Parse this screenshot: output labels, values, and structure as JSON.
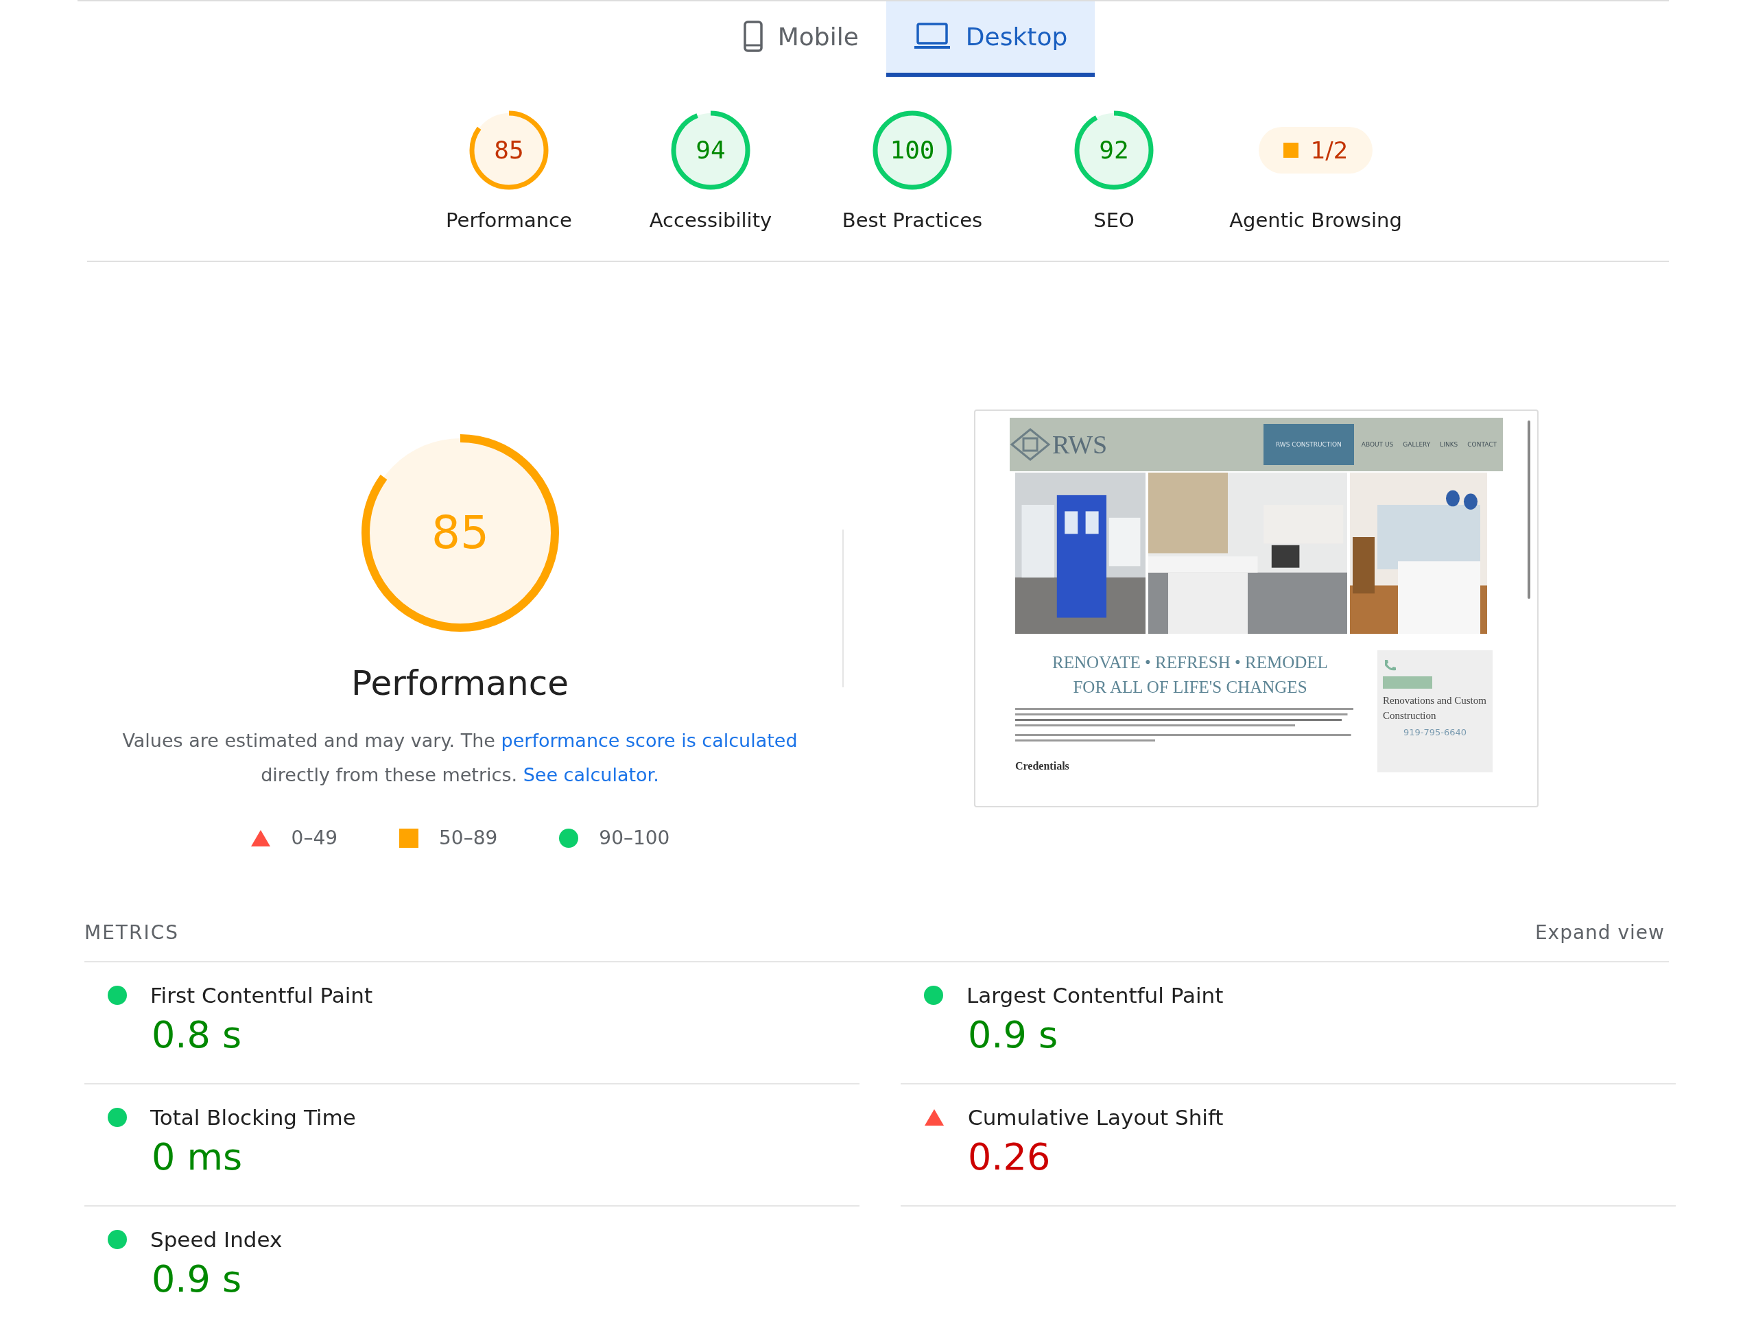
{
  "tabs": [
    {
      "label": "Mobile",
      "kind": "mobile",
      "selected": false
    },
    {
      "label": "Desktop",
      "kind": "desktop",
      "selected": true
    }
  ],
  "categories": [
    {
      "score": "85",
      "label": "Performance",
      "kind": "gauge",
      "color": "#ffa400",
      "level": 0.85
    },
    {
      "score": "94",
      "label": "Accessibility",
      "kind": "gauge",
      "color": "#0cce6b",
      "level": 0.94
    },
    {
      "score": "100",
      "label": "Best Practices",
      "kind": "gauge",
      "color": "#0cce6b",
      "level": 1
    },
    {
      "score": "92",
      "label": "SEO",
      "kind": "gauge",
      "color": "#0cce6b",
      "level": 0.92
    },
    {
      "score": "1/2",
      "label": "Agentic Browsing",
      "kind": "fraction",
      "color": "#ffa400"
    }
  ],
  "performance": {
    "score": "85",
    "level": 0.85,
    "color": "#ffa400",
    "title": "Performance",
    "description": [
      {
        "kind": "text",
        "text": "Values are estimated and may vary. The "
      },
      {
        "kind": "link",
        "text": "performance score is calculated"
      },
      {
        "kind": "text",
        "text": " directly from these metrics. "
      },
      {
        "kind": "link",
        "text": "See calculator."
      }
    ],
    "legend": [
      {
        "kind": "triangle",
        "color": "#ff4e42",
        "range": "0–49"
      },
      {
        "kind": "square",
        "color": "#ffa400",
        "range": "50–89"
      },
      {
        "kind": "circle",
        "color": "#0cce6b",
        "range": "90–100"
      }
    ]
  },
  "preview": {
    "logo": "RWS",
    "nav": [
      {
        "label": "RWS CONSTRUCTION",
        "selected": true
      },
      {
        "label": "ABOUT US",
        "selected": false
      },
      {
        "label": "GALLERY",
        "selected": false
      },
      {
        "label": "LINKS",
        "selected": false
      },
      {
        "label": "CONTACT",
        "selected": false
      }
    ],
    "pictures": [
      {
        "kind": "picture"
      },
      {
        "kind": "picture"
      },
      {
        "kind": "picture"
      }
    ],
    "headline": [
      "RENOVATE • REFRESH • REMODEL",
      "FOR ALL OF LIFE'S CHANGES"
    ],
    "subheading": "Credentials",
    "sidebar": {
      "title": "Renovations and Custom Construction",
      "phone": "919-795-6640"
    }
  },
  "metrics": {
    "heading": "METRICS",
    "expand": "Expand view",
    "items": [
      {
        "label": "First Contentful Paint",
        "value": "0.8 s",
        "kind": "circle",
        "color": "#0cce6b"
      },
      {
        "label": "Largest Contentful Paint",
        "value": "0.9 s",
        "kind": "circle",
        "color": "#0cce6b"
      },
      {
        "label": "Total Blocking Time",
        "value": "0 ms",
        "kind": "circle",
        "color": "#0cce6b"
      },
      {
        "label": "Cumulative Layout Shift",
        "value": "0.26",
        "kind": "triangle",
        "color": "#ff4e42"
      },
      {
        "label": "Speed Index",
        "value": "0.9 s",
        "kind": "circle",
        "color": "#0cce6b"
      }
    ]
  }
}
